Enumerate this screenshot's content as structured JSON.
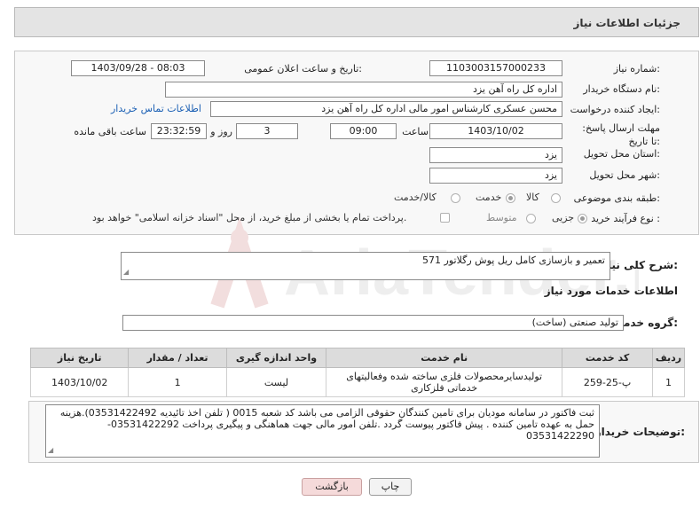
{
  "header": {
    "title": "جزئیات اطلاعات نیاز"
  },
  "fields": {
    "need_number_label": "شماره نیاز:",
    "need_number": "1103003157000233",
    "announce_label": "تاریخ و ساعت اعلان عمومی:",
    "announce_value": "1403/09/28 - 08:03",
    "buyer_org_label": "نام دستگاه خریدار:",
    "buyer_org": "اداره کل راه آهن یزد",
    "creator_label": "ایجاد کننده درخواست:",
    "creator": "محسن عسکری کارشناس امور مالی اداره کل راه آهن یزد",
    "contact_link": "اطلاعات تماس خریدار",
    "deadline_label": "مهلت ارسال پاسخ: تا تاریخ:",
    "deadline_date": "1403/10/02",
    "time_label": "ساعت",
    "deadline_time": "09:00",
    "days_value": "3",
    "days_label": "روز و",
    "remaining_value": "23:32:59",
    "remaining_label": "ساعت باقی مانده",
    "province_label": "استان محل تحویل:",
    "province": "یزد",
    "city_label": "شهر محل تحویل:",
    "city": "یزد",
    "category_label": "طبقه بندی موضوعی:",
    "category_options": [
      "کالا",
      "خدمت",
      "کالا/خدمت"
    ],
    "category_selected": "خدمت",
    "process_label": "نوع فرآیند خرید :",
    "process_options": [
      "جزیی",
      "متوسط"
    ],
    "process_selected": "جزیی",
    "payment_note": "پرداخت تمام یا بخشی از مبلغ خرید، از محل \"اسناد خزانه اسلامی\" خواهد بود."
  },
  "summary": {
    "label": "شرح کلی نیاز:",
    "text": "تعمیر و بازسازی کامل ریل پوش رگلاتور 571"
  },
  "services": {
    "section_title": "اطلاعات خدمات مورد نیاز",
    "group_label": "گروه خدمت:",
    "group_value": "تولید صنعتی (ساخت)",
    "columns": [
      "ردیف",
      "کد خدمت",
      "نام خدمت",
      "واحد اندازه گیری",
      "تعداد / مقدار",
      "تاریخ نیاز"
    ],
    "rows": [
      [
        "1",
        "پ-25-259",
        "تولیدسایرمحصولات فلزی ساخته شده وفعالیتهای خدماتی فلزکاری",
        "لیست",
        "1",
        "1403/10/02"
      ]
    ]
  },
  "buyer_notes": {
    "label": "توضیحات خریدار:",
    "text": "ثبت فاکتور در سامانه مودیان برای تامین کنندگان حقوقی الزامی می باشد کد شعبه 0015 ( تلفن اخذ تائیدیه 03531422492).هزینه حمل به عهده تامین کننده . پیش فاکتور پیوست گردد .تلفن امور مالی جهت هماهنگی و پیگیری پرداخت 03531422292-03531422290"
  },
  "buttons": {
    "print": "چاپ",
    "back": "بازگشت"
  },
  "watermark": "AriaTender.neT"
}
